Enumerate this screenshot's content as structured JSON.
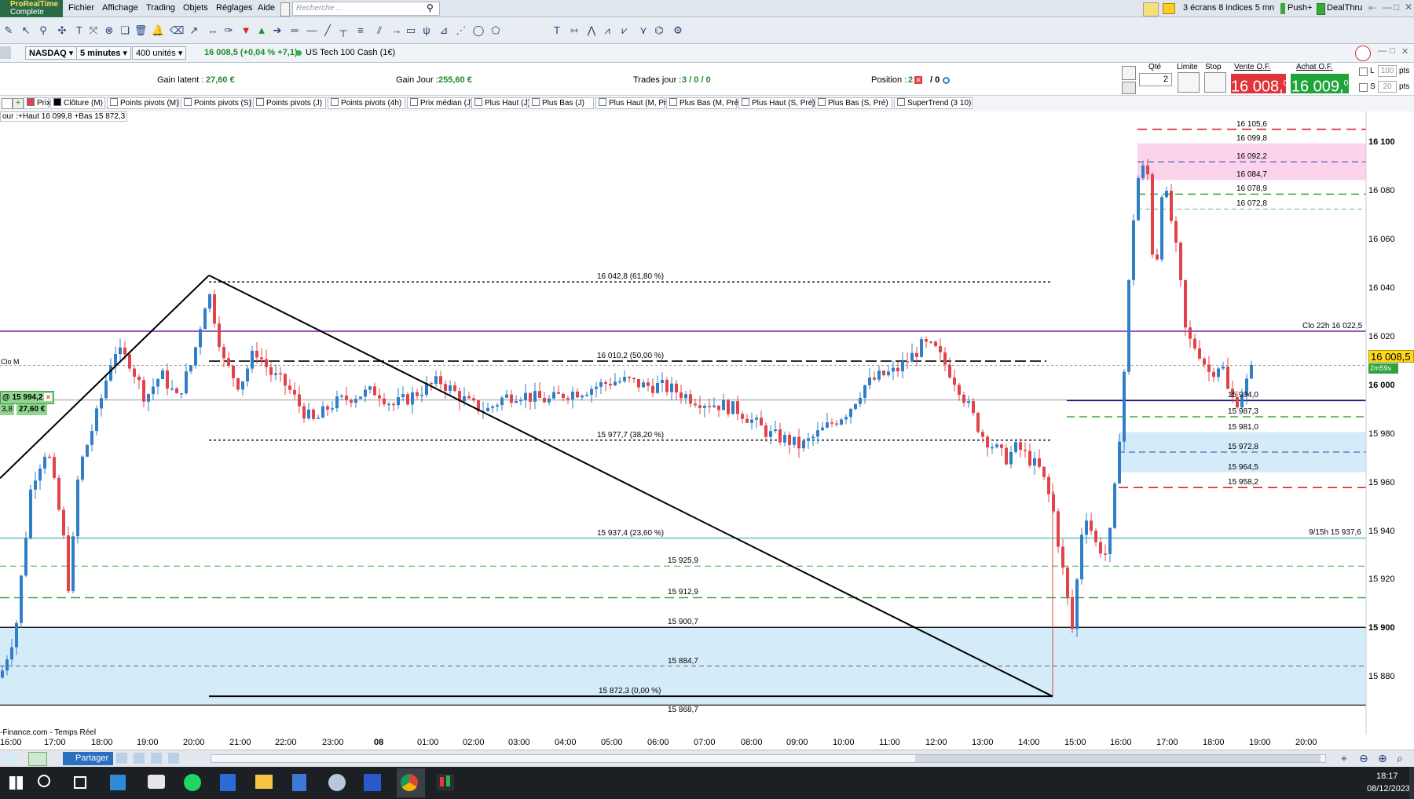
{
  "app": {
    "name": "ProRealTime",
    "edition": "Complete"
  },
  "menu": [
    "Fichier",
    "Affichage",
    "Trading",
    "Objets",
    "Réglages",
    "Aide"
  ],
  "search": {
    "placeholder": "Recherche ..."
  },
  "top_right": {
    "layout": "3 écrans 8 indices 5 mn",
    "push": "Push+",
    "dealthru": "DealThru"
  },
  "instrument": {
    "market": "NASDAQ",
    "timeframe": "5 minutes",
    "units": "400 unités",
    "quote": "16 008,5 (+0,04 % +7,1)",
    "name": "US Tech 100 Cash (1€)"
  },
  "info": {
    "gain_latent_label": "Gain latent :",
    "gain_latent": "27,60 €",
    "gain_jour_label": "Gain Jour :",
    "gain_jour": "255,60 €",
    "trades_label": "Trades jour :",
    "trades": "3 / 0 / 0",
    "position_label": "Position :",
    "position": "2",
    "position2": "/ 0"
  },
  "order_panel": {
    "qty_label": "Qté",
    "qty": "2",
    "limit_label": "Limite",
    "stop_label": "Stop",
    "sell_label": "Vente O.F.",
    "buy_label": "Achat O.F.",
    "sell_price": "16 008,",
    "sell_sup": "0",
    "buy_price": "16 009,",
    "buy_sup": "0",
    "l_label": "L",
    "l_val": "100",
    "s_label": "S",
    "s_val": "20",
    "pts": "pts"
  },
  "indicators": [
    "Prix",
    "Clôture (M)",
    "Points pivots (M)",
    "Points pivots (S)",
    "Points pivots (J)",
    "Points pivots (4h)",
    "Prix médian (J)",
    "Plus Haut (J)",
    "Plus Bas (J)",
    "Plus Haut (M, Pré)",
    "Plus Bas (M, Pré)",
    "Plus Haut (S, Pré)",
    "Plus Bas (S, Pré)",
    "SuperTrend (3 10)"
  ],
  "chart_header": "our :+Haut 16 099,8 +Bas 15 872,3",
  "position_tag": {
    "price": "@ 15 994,2",
    "qty": "3,8",
    "gain": "27,60 €"
  },
  "clo_label": "Clo M",
  "levels": {
    "fib_618": "16 042,8 (61,80 %)",
    "fib_50": "16 010,2 (50,00 %)",
    "fib_382": "15 977,7 (38,20 %)",
    "fib_236": "15 937,4 (23,60 %)",
    "fib_0": "15 872,3 (0,00 %)",
    "l15925": "15 925,9",
    "l15912": "15 912,9",
    "l15900": "15 900,7",
    "l15884": "15 884,7",
    "l15868": "15 868,7",
    "r16105": "16 105,6",
    "r16099": "16 099,8",
    "r16092": "16 092,2",
    "r16084": "16 084,7",
    "r16078": "16 078,9",
    "r16072": "16 072,8",
    "r15994": "15 994,0",
    "r15987": "15 987,3",
    "r15981": "15 981,0",
    "r15972": "15 972,8",
    "r15964": "15 964,5",
    "r15958": "15 958,2",
    "clo22": "Clo 22h 16 022,5",
    "h915": "9/15h 15 937,6"
  },
  "price_axis": [
    "16 100",
    "16 080",
    "16 060",
    "16 040",
    "16 020",
    "16 000",
    "15 980",
    "15 960",
    "15 940",
    "15 920",
    "15 900",
    "15 880"
  ],
  "price_tag_current": "16 008,5",
  "price_tag_timer": "2m59s",
  "time_axis": [
    "16:00",
    "17:00",
    "18:00",
    "19:00",
    "20:00",
    "21:00",
    "22:00",
    "23:00",
    "08",
    "01:00",
    "02:00",
    "03:00",
    "04:00",
    "05:00",
    "06:00",
    "07:00",
    "08:00",
    "09:00",
    "10:00",
    "11:00",
    "12:00",
    "13:00",
    "14:00",
    "15:00",
    "16:00",
    "17:00",
    "18:00",
    "19:00",
    "20:00"
  ],
  "footer_source": "-Finance.com - Temps Réel",
  "bottom": {
    "share": "Partager"
  },
  "clock": {
    "time": "18:17",
    "date": "08/12/2023"
  },
  "colors": {
    "up": "#2f7fc8",
    "down": "#e0444a",
    "purple": "#7a1fa8",
    "cyan": "#39a9c9",
    "green_dash": "#3aa83a",
    "red_dash": "#d9262a",
    "zone_blue": "#d4ecfa",
    "zone_pink": "#fbd3ea"
  }
}
